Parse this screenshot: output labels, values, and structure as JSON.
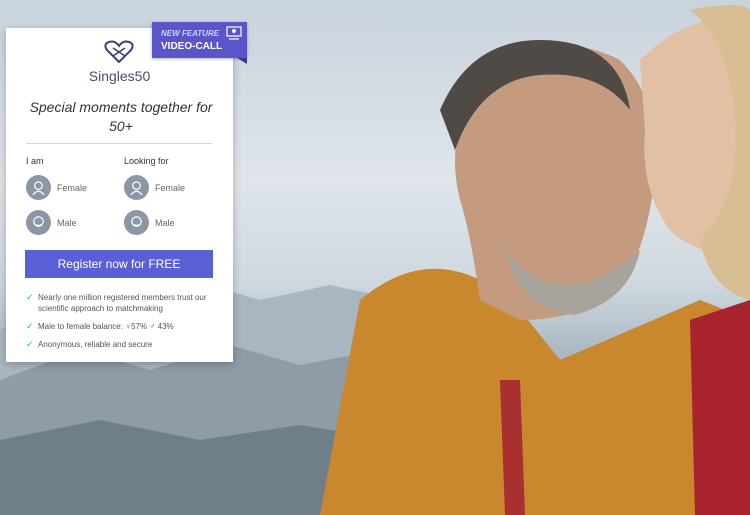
{
  "badge": {
    "line1": "NEW FEATURE",
    "line2": "VIDEO-CALL",
    "icon": "video-call-icon"
  },
  "brand": {
    "name": "Singles50",
    "icon": "heart-logo-icon"
  },
  "tagline": "Special moments together for 50+",
  "form": {
    "i_am": {
      "label": "I am",
      "options": [
        "Female",
        "Male"
      ]
    },
    "looking_for": {
      "label": "Looking for",
      "options": [
        "Female",
        "Male"
      ]
    }
  },
  "cta_label": "Register now for FREE",
  "benefits": [
    "Nearly one million registered members trust our scientific approach to matchmaking",
    "Male to female balance: ♀57% ♂ 43%",
    "Anonymous, reliable and secure"
  ],
  "colors": {
    "accent": "#5a5fd6",
    "badge": "#5a55c9",
    "check": "#29b7a0"
  }
}
